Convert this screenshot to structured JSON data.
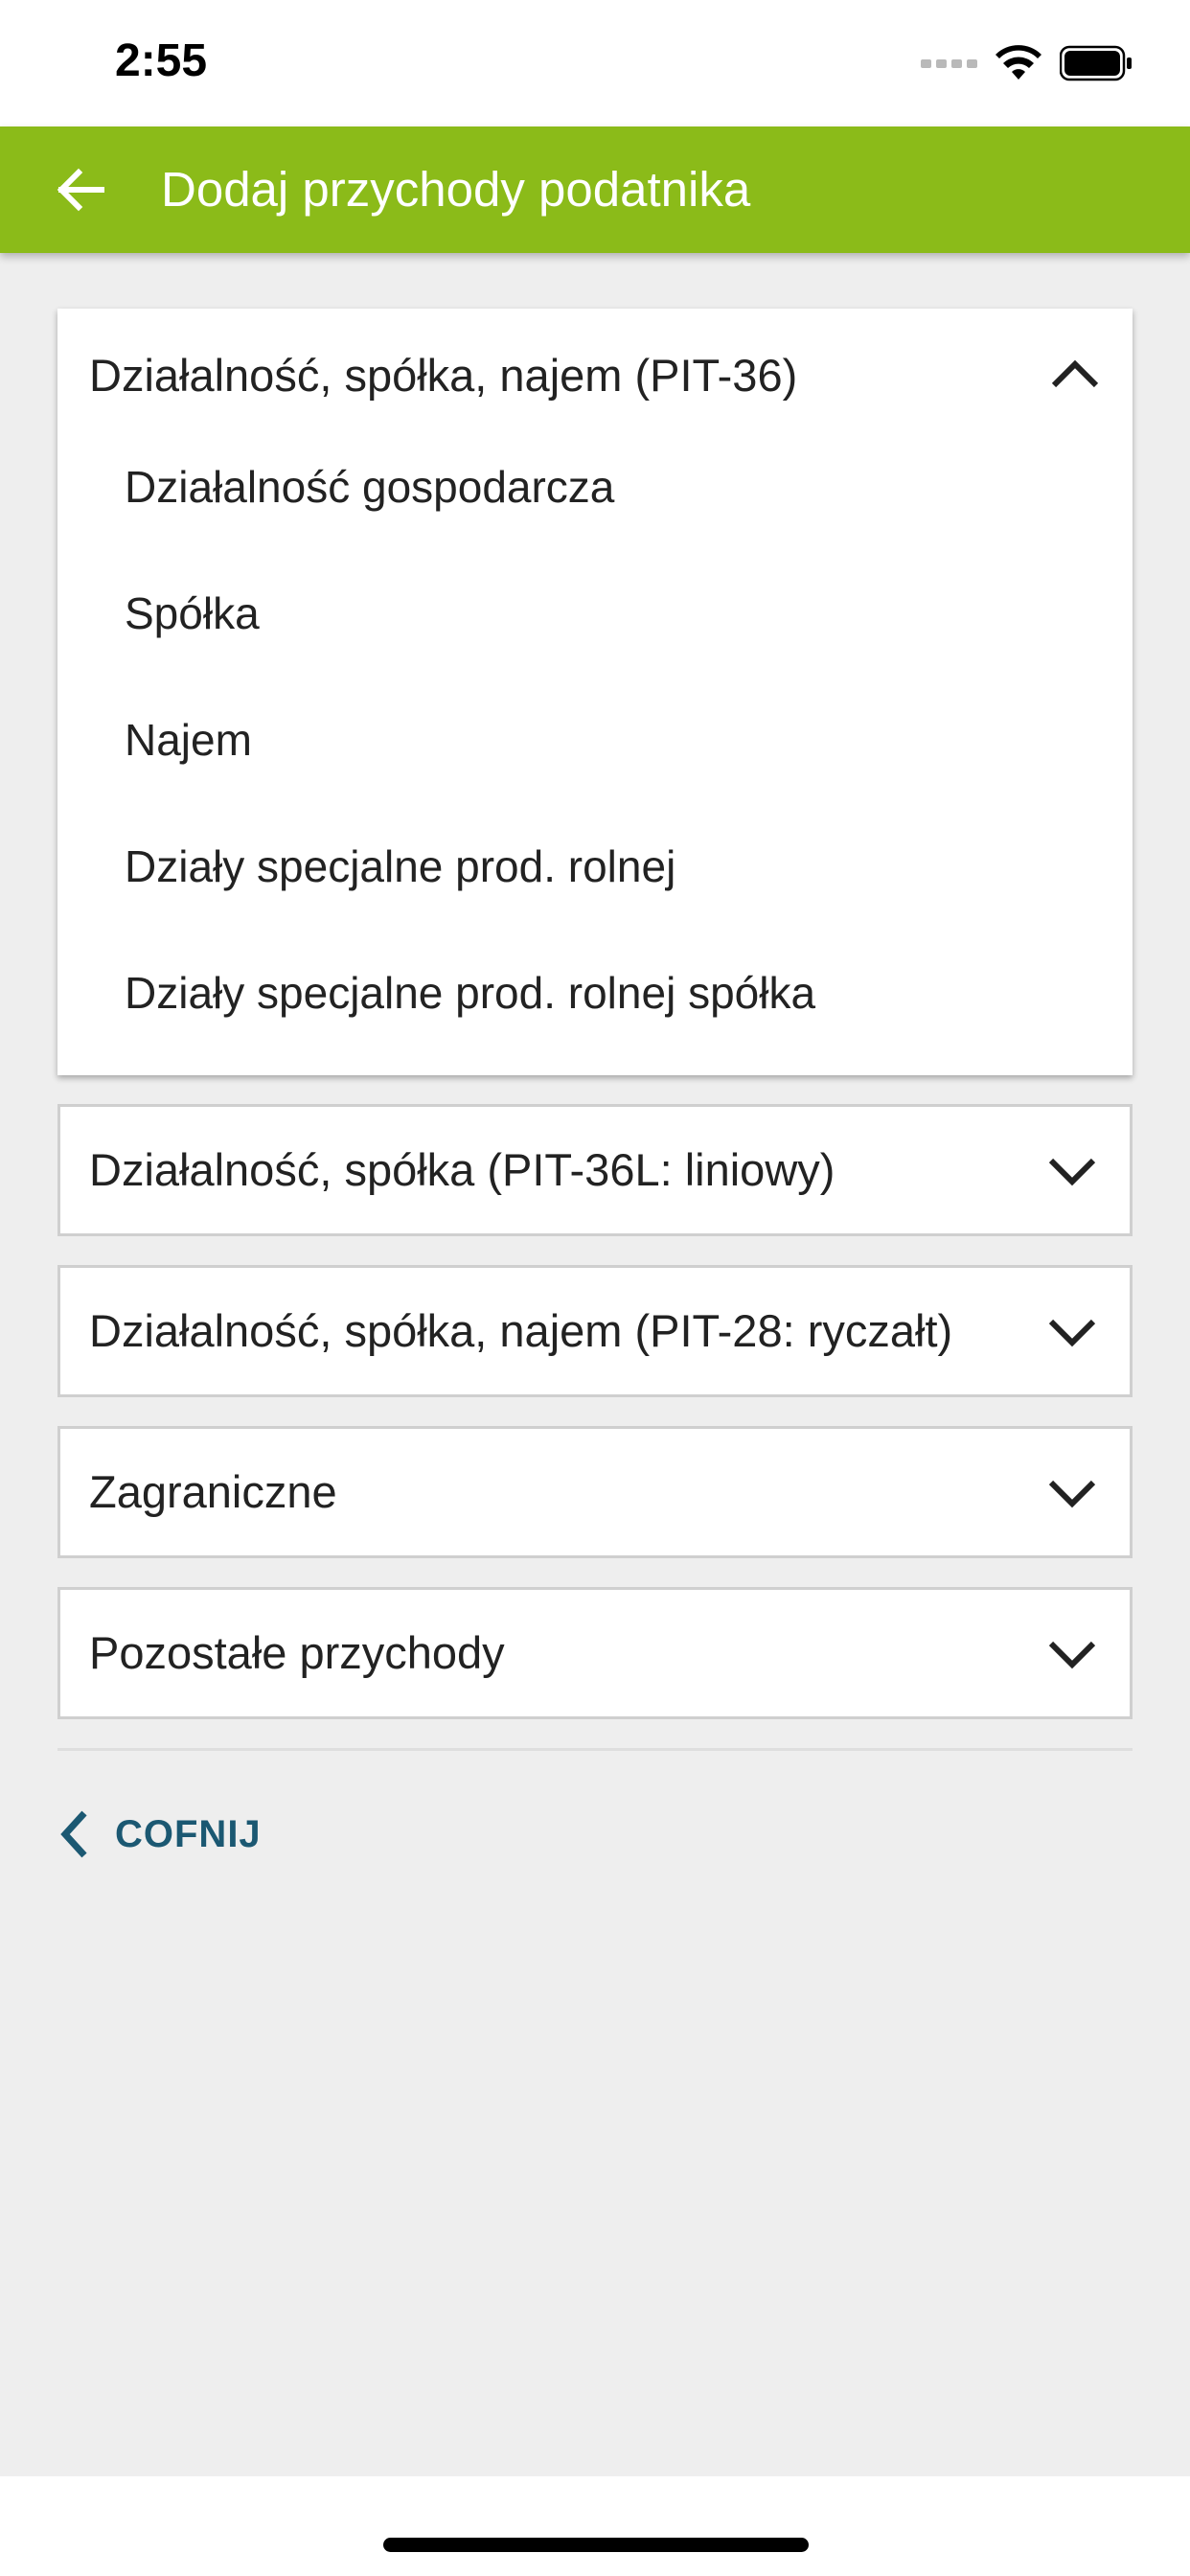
{
  "status_bar": {
    "time": "2:55",
    "icons": [
      "signal-dots-icon",
      "wifi-icon",
      "battery-icon"
    ]
  },
  "app_bar": {
    "title": "Dodaj przychody podatnika",
    "back_icon": "arrow-left-icon",
    "color": "#8bbb19"
  },
  "sections": [
    {
      "label": "Działalność, spółka, najem (PIT-36)",
      "expanded": true,
      "items": [
        "Działalność gospodarcza",
        "Spółka",
        "Najem",
        "Działy specjalne prod. rolnej",
        "Działy specjalne prod. rolnej spółka"
      ]
    },
    {
      "label": "Działalność, spółka (PIT-36L: liniowy)",
      "expanded": false
    },
    {
      "label": "Działalność, spółka, najem (PIT-28: ryczałt)",
      "expanded": false
    },
    {
      "label": "Zagraniczne",
      "expanded": false
    },
    {
      "label": "Pozostałe przychody",
      "expanded": false
    }
  ],
  "footer": {
    "back_label": "COFNIJ",
    "back_color": "#1b5872"
  }
}
